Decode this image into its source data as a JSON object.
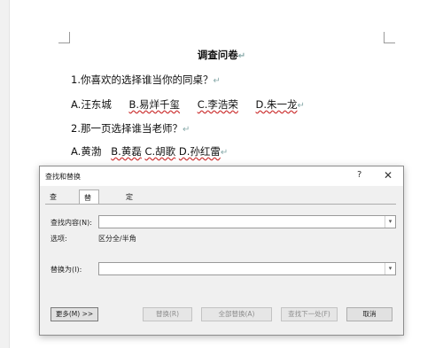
{
  "document": {
    "title": "调查问卷",
    "q1": "1.你喜欢的选择谁当你的同桌？",
    "q1_options": [
      "A.汪东城",
      "B.易烊千玺",
      "C.李浩荣",
      "D.朱一龙"
    ],
    "q2": "2.那一页选择谁当老师？",
    "q2_options": [
      "A.黄渤",
      "B.黄磊",
      "C.胡歌",
      "D.孙红雷"
    ],
    "paragraph_mark": "↵"
  },
  "dialog": {
    "title": "查找和替换",
    "help": "?",
    "close": "✕",
    "tabs": [
      {
        "label": "查找(D)",
        "active": false
      },
      {
        "label": "替换(P)",
        "active": true
      },
      {
        "label": "定位(G)",
        "active": false
      }
    ],
    "find_label": "查找内容(N):",
    "find_value": "",
    "options_label": "选项:",
    "options_value": "区分全/半角",
    "replace_label": "替换为(I):",
    "replace_value": "",
    "buttons": {
      "more": "更多(M) >>",
      "replace": "替换(R)",
      "replace_all": "全部替换(A)",
      "find_next": "查找下一处(F)",
      "cancel": "取消"
    }
  },
  "icons": {
    "dropdown": "chevron-down-icon"
  }
}
